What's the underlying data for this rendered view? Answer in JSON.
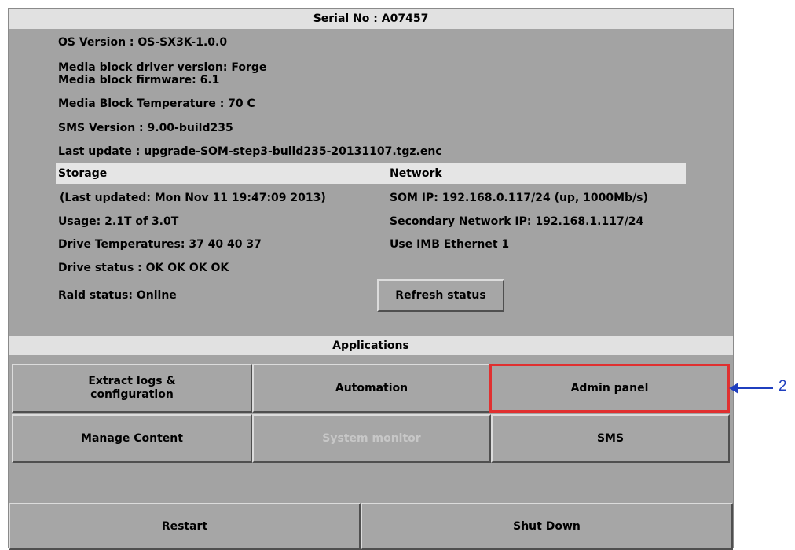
{
  "header": {
    "serial": "Serial No : A07457"
  },
  "info": {
    "os_version": "OS Version : OS-SX3K-1.0.0",
    "media_driver": "Media block driver version: Forge",
    "media_firmware": "Media block firmware: 6.1",
    "media_temp": "Media Block Temperature : 70 C",
    "sms_version": "SMS Version : 9.00-build235",
    "last_update": "Last update : upgrade-SOM-step3-build235-20131107.tgz.enc"
  },
  "storage": {
    "heading": "Storage",
    "last_updated": "(Last updated: Mon Nov 11 19:47:09 2013)",
    "usage": "Usage: 2.1T of 3.0T",
    "drive_temps": "Drive Temperatures: 37 40 40 37",
    "drive_status": "Drive status : OK OK OK OK",
    "raid_status": "Raid status: Online"
  },
  "network": {
    "heading": "Network",
    "som_ip": "SOM IP: 192.168.0.117/24 (up, 1000Mb/s)",
    "secondary_ip": "Secondary Network IP: 192.168.1.117/24",
    "ethernet": "Use IMB Ethernet 1"
  },
  "refresh_button": "Refresh status",
  "applications": {
    "heading": "Applications",
    "extract_logs_line1": "Extract logs &",
    "extract_logs_line2": "configuration",
    "automation": "Automation",
    "admin_panel": "Admin panel",
    "manage_content": "Manage Content",
    "system_monitor": "System monitor",
    "sms": "SMS"
  },
  "power": {
    "restart": "Restart",
    "shutdown": "Shut Down"
  },
  "callout": {
    "number": "2"
  },
  "colors": {
    "panel_bg": "#a3a3a3",
    "header_bg": "#e1e1e1",
    "highlight": "#e03030",
    "callout": "#1f3fbf",
    "disabled_text": "#c7c7c7"
  }
}
